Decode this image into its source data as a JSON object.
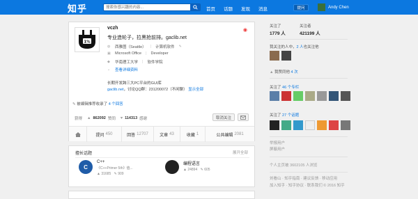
{
  "header": {
    "logo": "知乎",
    "search_placeholder": "搜索你感兴趣的内容...",
    "nav": [
      "首页",
      "话题",
      "发现",
      "消息"
    ],
    "ask_label": "提问",
    "username": "Andy Chen"
  },
  "profile": {
    "name": "vczh",
    "bio": "专业造轮子，拉黑抢前排。gaclib.net",
    "location": "西雅图（Seattle）",
    "industry": "计算机软件",
    "company": "Microsoft Office",
    "position": "Developer",
    "school": "华南理工大学",
    "major": "软件学院",
    "detail_link": "查看详细资料",
    "desc_line1": "长期开发跨三大PC平台的GUI库",
    "desc_link": "gaclib.net",
    "desc_line2": "，讨论QQ群：231200072（不闲聊）",
    "desc_more": "显示全部",
    "collected_prefix": "被编辑推荐收录了",
    "collected_count": "4 个回答",
    "stats_label": "获得",
    "upvotes": "862092",
    "upvote_label": "赞同",
    "thanks": "114313",
    "thanks_label": "感谢",
    "unfollow_label": "取消关注"
  },
  "tabs": [
    {
      "label": "提问",
      "count": "450"
    },
    {
      "label": "回答",
      "count": "12707"
    },
    {
      "label": "文章",
      "count": "43"
    },
    {
      "label": "收藏",
      "count": "1"
    },
    {
      "label": "公共编辑",
      "count": "2081"
    }
  ],
  "topics_card": {
    "title": "擅长话题",
    "more": "展开全部",
    "items": [
      {
        "name": "C++",
        "desc": "《C++Primer 5th》值...",
        "stat1": "31685",
        "stat2": "909"
      },
      {
        "name": "编程语言",
        "desc": "",
        "stat1": "24894",
        "stat2": "605"
      }
    ]
  },
  "sidebar": {
    "following_label": "关注了",
    "following": "1779 人",
    "followers_label": "关注者",
    "followers": "421199 人",
    "mutual_prefix": "我关注的人中，",
    "mutual_count": "2 人",
    "mutual_suffix": "也关注他",
    "mutual_more": "个",
    "home_label": "我赞同他",
    "home_count": "4 次",
    "columns_prefix": "关注了",
    "columns_count": "46 个专栏",
    "topics_prefix": "关注了",
    "topics_count": "27 个话题",
    "block1": "举报用户",
    "block2": "屏蔽用户",
    "views": "个人主页被 3602105 人浏览",
    "footer1": "刘看山 · 知乎指南 · 建议反馈 · 移动应用",
    "footer2": "加入知乎 · 知乎协议 · 联系我们 © 2016 知乎"
  },
  "colors": {
    "brand": "#0c78e0"
  }
}
